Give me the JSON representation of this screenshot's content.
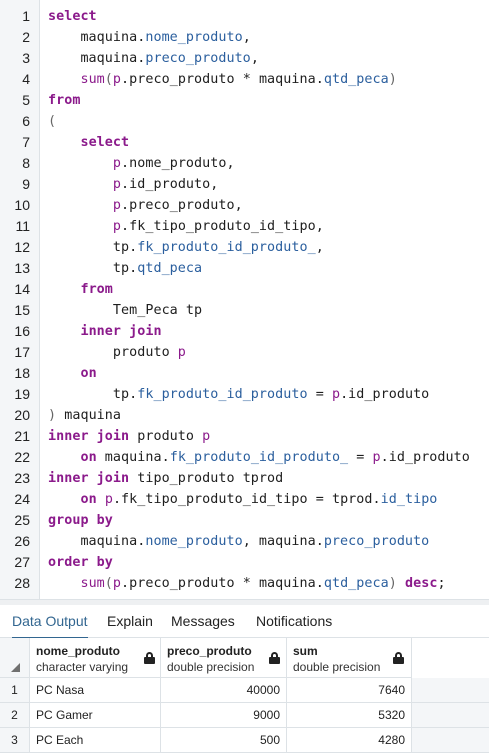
{
  "editor": {
    "lines": [
      {
        "n": "1",
        "tokens": [
          [
            "kw",
            "select"
          ]
        ]
      },
      {
        "n": "2",
        "tokens": [
          [
            "",
            "    maquina."
          ],
          [
            "fld",
            "nome_produto"
          ],
          [
            "",
            ","
          ]
        ]
      },
      {
        "n": "3",
        "tokens": [
          [
            "",
            "    maquina."
          ],
          [
            "fld",
            "preco_produto"
          ],
          [
            "",
            ","
          ]
        ]
      },
      {
        "n": "4",
        "tokens": [
          [
            "",
            "    "
          ],
          [
            "fn",
            "sum"
          ],
          [
            "pn",
            "("
          ],
          [
            "al",
            "p"
          ],
          [
            "",
            ".preco_produto * maquina."
          ],
          [
            "fld",
            "qtd_peca"
          ],
          [
            "pn",
            ")"
          ]
        ]
      },
      {
        "n": "5",
        "tokens": [
          [
            "kw",
            "from"
          ]
        ]
      },
      {
        "n": "6",
        "tokens": [
          [
            "pn",
            "("
          ]
        ]
      },
      {
        "n": "7",
        "tokens": [
          [
            "",
            "    "
          ],
          [
            "kw",
            "select"
          ]
        ]
      },
      {
        "n": "8",
        "tokens": [
          [
            "",
            "        "
          ],
          [
            "al",
            "p"
          ],
          [
            "",
            ".nome_produto,"
          ]
        ]
      },
      {
        "n": "9",
        "tokens": [
          [
            "",
            "        "
          ],
          [
            "al",
            "p"
          ],
          [
            "",
            ".id_produto,"
          ]
        ]
      },
      {
        "n": "10",
        "tokens": [
          [
            "",
            "        "
          ],
          [
            "al",
            "p"
          ],
          [
            "",
            ".preco_produto,"
          ]
        ]
      },
      {
        "n": "11",
        "tokens": [
          [
            "",
            "        "
          ],
          [
            "al",
            "p"
          ],
          [
            "",
            ".fk_tipo_produto_id_tipo,"
          ]
        ]
      },
      {
        "n": "12",
        "tokens": [
          [
            "",
            "        tp."
          ],
          [
            "fld",
            "fk_produto_id_produto_"
          ],
          [
            "",
            ","
          ]
        ]
      },
      {
        "n": "13",
        "tokens": [
          [
            "",
            "        tp."
          ],
          [
            "fld",
            "qtd_peca"
          ]
        ]
      },
      {
        "n": "14",
        "tokens": [
          [
            "",
            "    "
          ],
          [
            "kw",
            "from"
          ]
        ]
      },
      {
        "n": "15",
        "tokens": [
          [
            "",
            "        Tem_Peca tp"
          ]
        ]
      },
      {
        "n": "16",
        "tokens": [
          [
            "",
            "    "
          ],
          [
            "kw",
            "inner join"
          ]
        ]
      },
      {
        "n": "17",
        "tokens": [
          [
            "",
            "        produto "
          ],
          [
            "al",
            "p"
          ]
        ]
      },
      {
        "n": "18",
        "tokens": [
          [
            "",
            "    "
          ],
          [
            "kw",
            "on"
          ]
        ]
      },
      {
        "n": "19",
        "tokens": [
          [
            "",
            "        tp."
          ],
          [
            "fld",
            "fk_produto_id_produto"
          ],
          [
            "",
            " = "
          ],
          [
            "al",
            "p"
          ],
          [
            "",
            ".id_produto"
          ]
        ]
      },
      {
        "n": "20",
        "tokens": [
          [
            "pn",
            ")"
          ],
          [
            "",
            " maquina"
          ]
        ]
      },
      {
        "n": "21",
        "tokens": [
          [
            "kw",
            "inner join"
          ],
          [
            "",
            " produto "
          ],
          [
            "al",
            "p"
          ]
        ]
      },
      {
        "n": "22",
        "tokens": [
          [
            "",
            "    "
          ],
          [
            "kw",
            "on"
          ],
          [
            "",
            " maquina."
          ],
          [
            "fld",
            "fk_produto_id_produto_"
          ],
          [
            "",
            " = "
          ],
          [
            "al",
            "p"
          ],
          [
            "",
            ".id_produto"
          ]
        ]
      },
      {
        "n": "23",
        "tokens": [
          [
            "kw",
            "inner join"
          ],
          [
            "",
            " tipo_produto tprod"
          ]
        ]
      },
      {
        "n": "24",
        "tokens": [
          [
            "",
            "    "
          ],
          [
            "kw",
            "on"
          ],
          [
            "",
            " "
          ],
          [
            "al",
            "p"
          ],
          [
            "",
            ".fk_tipo_produto_id_tipo = tprod."
          ],
          [
            "fld",
            "id_tipo"
          ]
        ]
      },
      {
        "n": "25",
        "tokens": [
          [
            "kw",
            "group by"
          ]
        ]
      },
      {
        "n": "26",
        "tokens": [
          [
            "",
            "    maquina."
          ],
          [
            "fld",
            "nome_produto"
          ],
          [
            "",
            ", maquina."
          ],
          [
            "fld",
            "preco_produto"
          ]
        ]
      },
      {
        "n": "27",
        "tokens": [
          [
            "kw",
            "order by"
          ]
        ]
      },
      {
        "n": "28",
        "tokens": [
          [
            "",
            "    "
          ],
          [
            "fn",
            "sum"
          ],
          [
            "pn",
            "("
          ],
          [
            "al",
            "p"
          ],
          [
            "",
            ".preco_produto * maquina."
          ],
          [
            "fld",
            "qtd_peca"
          ],
          [
            "pn",
            ")"
          ],
          [
            "",
            " "
          ],
          [
            "kw",
            "desc"
          ],
          [
            "",
            ";"
          ]
        ]
      }
    ]
  },
  "tabs": [
    {
      "label": "Data Output",
      "active": true
    },
    {
      "label": "Explain",
      "active": false
    },
    {
      "label": "Messages",
      "active": false
    },
    {
      "label": "Notifications",
      "active": false
    }
  ],
  "grid": {
    "columns": [
      {
        "name": "nome_produto",
        "type": "character varying",
        "locked": true
      },
      {
        "name": "preco_produto",
        "type": "double precision",
        "locked": true
      },
      {
        "name": "sum",
        "type": "double precision",
        "locked": true
      }
    ],
    "rows": [
      {
        "n": "1",
        "cells": [
          "PC Nasa",
          "40000",
          "7640"
        ]
      },
      {
        "n": "2",
        "cells": [
          "PC Gamer",
          "9000",
          "5320"
        ]
      },
      {
        "n": "3",
        "cells": [
          "PC Each",
          "500",
          "4280"
        ]
      }
    ]
  },
  "colors": {
    "keyword": "#8b1a8b",
    "field": "#2b5f9e",
    "active_tab": "#326690"
  }
}
